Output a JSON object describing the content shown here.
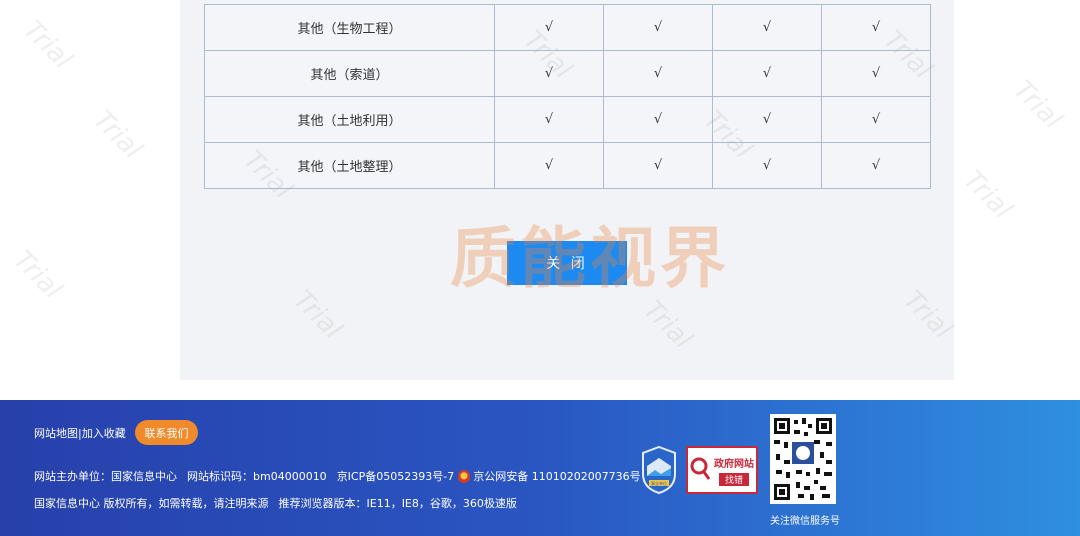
{
  "table": {
    "rows": [
      {
        "name": "其他（生物工程）",
        "marks": [
          "√",
          "√",
          "√",
          "√"
        ]
      },
      {
        "name": "其他（索道）",
        "marks": [
          "√",
          "√",
          "√",
          "√"
        ]
      },
      {
        "name": "其他（土地利用）",
        "marks": [
          "√",
          "√",
          "√",
          "√"
        ]
      },
      {
        "name": "其他（土地整理）",
        "marks": [
          "√",
          "√",
          "√",
          "√"
        ]
      }
    ]
  },
  "close_button": "关 闭",
  "watermark_text": "质能视界",
  "trial_text": "Trial",
  "footer": {
    "sitemap": "网站地图",
    "separator": " | ",
    "bookmark": "加入收藏",
    "contact": "联系我们",
    "line1_host": "网站主办单位：国家信息中心",
    "line1_id": "网站标识码：bm04000010",
    "line1_icp": "京ICP备05052393号-7",
    "line1_police": "京公网安备 11010202007736号",
    "line2_copyright": "国家信息中心 版权所有，如需转载，请注明来源",
    "line2_browser": "推荐浏览器版本：IE11，IE8，谷歌，360极速版",
    "gov_badge_line1": "政府网站",
    "gov_badge_line2": "找错",
    "badge1_text": "事业单位",
    "qr_caption": "关注微信服务号"
  },
  "colors": {
    "accent_blue": "#1c8af0",
    "footer_start": "#2740aa",
    "footer_end": "#2f8fe0",
    "contact_orange": "#f08a2a",
    "gov_red": "#c8283a"
  }
}
